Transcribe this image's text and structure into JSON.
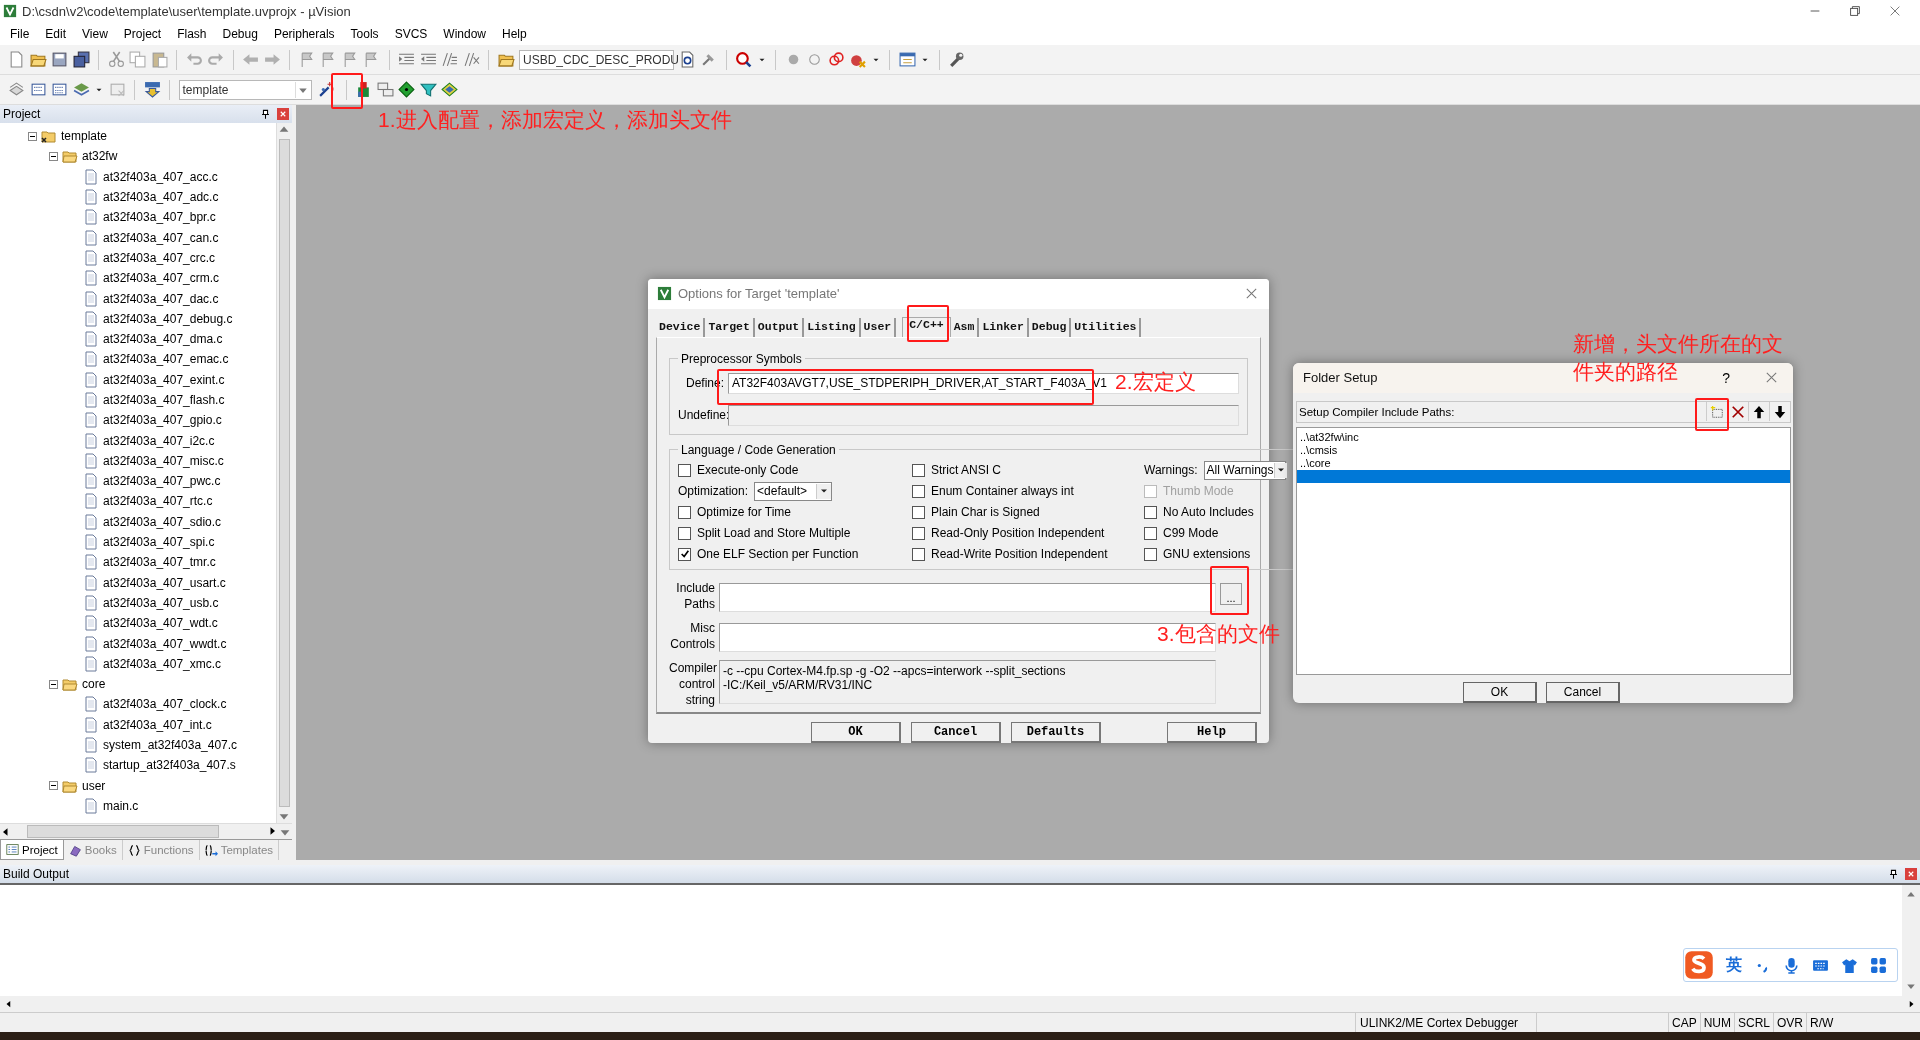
{
  "window": {
    "title": "D:\\csdn\\v2\\code\\template\\user\\template.uvprojx - µVision"
  },
  "menu": [
    "File",
    "Edit",
    "View",
    "Project",
    "Flash",
    "Debug",
    "Peripherals",
    "Tools",
    "SVCS",
    "Window",
    "Help"
  ],
  "toolbar": {
    "device_dropdown": "USBD_CDC_DESC_PRODU",
    "target_dropdown": "template"
  },
  "project_panel": {
    "title": "Project",
    "tree": [
      {
        "label": "template",
        "kind": "target",
        "expanded": true,
        "children": [
          {
            "label": "at32fw",
            "kind": "folder",
            "expanded": true,
            "children": [
              {
                "label": "at32f403a_407_acc.c",
                "kind": "file"
              },
              {
                "label": "at32f403a_407_adc.c",
                "kind": "file"
              },
              {
                "label": "at32f403a_407_bpr.c",
                "kind": "file"
              },
              {
                "label": "at32f403a_407_can.c",
                "kind": "file"
              },
              {
                "label": "at32f403a_407_crc.c",
                "kind": "file"
              },
              {
                "label": "at32f403a_407_crm.c",
                "kind": "file"
              },
              {
                "label": "at32f403a_407_dac.c",
                "kind": "file"
              },
              {
                "label": "at32f403a_407_debug.c",
                "kind": "file"
              },
              {
                "label": "at32f403a_407_dma.c",
                "kind": "file"
              },
              {
                "label": "at32f403a_407_emac.c",
                "kind": "file"
              },
              {
                "label": "at32f403a_407_exint.c",
                "kind": "file"
              },
              {
                "label": "at32f403a_407_flash.c",
                "kind": "file"
              },
              {
                "label": "at32f403a_407_gpio.c",
                "kind": "file"
              },
              {
                "label": "at32f403a_407_i2c.c",
                "kind": "file"
              },
              {
                "label": "at32f403a_407_misc.c",
                "kind": "file"
              },
              {
                "label": "at32f403a_407_pwc.c",
                "kind": "file"
              },
              {
                "label": "at32f403a_407_rtc.c",
                "kind": "file"
              },
              {
                "label": "at32f403a_407_sdio.c",
                "kind": "file"
              },
              {
                "label": "at32f403a_407_spi.c",
                "kind": "file"
              },
              {
                "label": "at32f403a_407_tmr.c",
                "kind": "file"
              },
              {
                "label": "at32f403a_407_usart.c",
                "kind": "file"
              },
              {
                "label": "at32f403a_407_usb.c",
                "kind": "file"
              },
              {
                "label": "at32f403a_407_wdt.c",
                "kind": "file"
              },
              {
                "label": "at32f403a_407_wwdt.c",
                "kind": "file"
              },
              {
                "label": "at32f403a_407_xmc.c",
                "kind": "file"
              }
            ]
          },
          {
            "label": "core",
            "kind": "folder",
            "expanded": true,
            "children": [
              {
                "label": "at32f403a_407_clock.c",
                "kind": "file"
              },
              {
                "label": "at32f403a_407_int.c",
                "kind": "file"
              },
              {
                "label": "system_at32f403a_407.c",
                "kind": "file"
              },
              {
                "label": "startup_at32f403a_407.s",
                "kind": "file"
              }
            ]
          },
          {
            "label": "user",
            "kind": "folder",
            "expanded": true,
            "children": [
              {
                "label": "main.c",
                "kind": "file"
              }
            ]
          }
        ]
      }
    ],
    "tabs": [
      {
        "label": "Project",
        "selected": true
      },
      {
        "label": "Books",
        "selected": false
      },
      {
        "label": "Functions",
        "selected": false
      },
      {
        "label": "Templates",
        "selected": false
      }
    ]
  },
  "build_output": {
    "title": "Build Output"
  },
  "status_bar": [
    {
      "text": "ULINK2/ME Cortex Debugger"
    },
    {
      "text": "CAP"
    },
    {
      "text": "NUM"
    },
    {
      "text": "SCRL"
    },
    {
      "text": "OVR"
    },
    {
      "text": "R/W"
    }
  ],
  "options_dialog": {
    "title": "Options for Target 'template'",
    "tabs": [
      {
        "label": "Device",
        "selected": false
      },
      {
        "label": "Target",
        "selected": false
      },
      {
        "label": "Output",
        "selected": false
      },
      {
        "label": "Listing",
        "selected": false
      },
      {
        "label": "User",
        "selected": false
      },
      {
        "label": "C/C++",
        "selected": true
      },
      {
        "label": "Asm",
        "selected": false
      },
      {
        "label": "Linker",
        "selected": false
      },
      {
        "label": "Debug",
        "selected": false
      },
      {
        "label": "Utilities",
        "selected": false
      }
    ],
    "preprocessor": {
      "title": "Preprocessor Symbols",
      "define_label": "Define:",
      "define": "AT32F403AVGT7,USE_STDPERIPH_DRIVER,AT_START_F403A_V1",
      "undefine_label": "Undefine:"
    },
    "language": {
      "title": "Language / Code Generation",
      "columns": [
        [
          {
            "kind": "checkbox",
            "label": "Execute-only Code",
            "checked": false,
            "disabled": false
          },
          {
            "kind": "dropdown",
            "label": "Optimization:",
            "value": "<default>",
            "disabled": false
          },
          {
            "kind": "checkbox",
            "label": "Optimize for Time",
            "checked": false,
            "disabled": false
          },
          {
            "kind": "checkbox",
            "label": "Split Load and Store Multiple",
            "checked": false,
            "disabled": false
          },
          {
            "kind": "checkbox",
            "label": "One ELF Section per Function",
            "checked": true,
            "disabled": false
          }
        ],
        [
          {
            "kind": "checkbox",
            "label": "Strict ANSI C",
            "checked": false,
            "disabled": false
          },
          {
            "kind": "checkbox",
            "label": "Enum Container always int",
            "checked": false,
            "disabled": false
          },
          {
            "kind": "checkbox",
            "label": "Plain Char is Signed",
            "checked": false,
            "disabled": false
          },
          {
            "kind": "checkbox",
            "label": "Read-Only Position Independent",
            "checked": false,
            "disabled": false
          },
          {
            "kind": "checkbox",
            "label": "Read-Write Position Independent",
            "checked": false,
            "disabled": false
          }
        ],
        [
          {
            "kind": "dropdown",
            "label": "Warnings:",
            "value": "All Warnings",
            "disabled": false
          },
          {
            "kind": "checkbox",
            "label": "Thumb Mode",
            "checked": false,
            "disabled": true
          },
          {
            "kind": "checkbox",
            "label": "No Auto Includes",
            "checked": false,
            "disabled": false
          },
          {
            "kind": "checkbox",
            "label": "C99 Mode",
            "checked": false,
            "disabled": false
          },
          {
            "kind": "checkbox",
            "label": "GNU extensions",
            "checked": false,
            "disabled": false
          }
        ]
      ]
    },
    "include_paths_label": "Include Paths",
    "browse_button": "...",
    "misc_controls_label": "Misc Controls",
    "compiler_label": "Compiler control string",
    "compiler_string": "-c --cpu Cortex-M4.fp.sp -g -O2 --apcs=interwork --split_sections\n-IC:/Keil_v5/ARM/RV31/INC",
    "buttons": [
      "OK",
      "Cancel",
      "Defaults",
      "Help"
    ]
  },
  "folder_setup": {
    "title": "Folder Setup",
    "help": "?",
    "label": "Setup Compiler Include Paths:",
    "paths": [
      {
        "text": "..\\at32fw\\inc",
        "selected": false
      },
      {
        "text": "..\\cmsis",
        "selected": false
      },
      {
        "text": "..\\core",
        "selected": false
      },
      {
        "selected": true
      }
    ],
    "buttons": [
      "OK",
      "Cancel"
    ]
  },
  "annotations": [
    {
      "text": "1.进入配置，添加宏定义，添加头文件"
    },
    {
      "text": "2.宏定义"
    },
    {
      "text": "3.包含的文件"
    },
    {
      "text": "新增，头文件所在的文"
    },
    {
      "text": "件夹的路径"
    }
  ],
  "ime_bar": {
    "mode": "英"
  }
}
